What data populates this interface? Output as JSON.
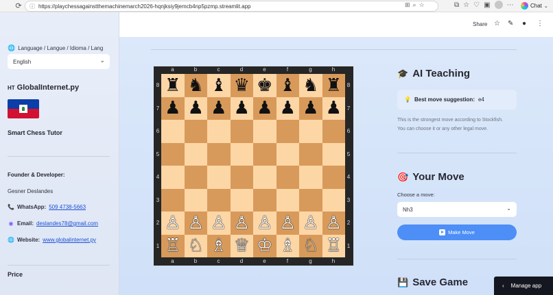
{
  "browser": {
    "url": "https://playchessagainstthemachinemarch2026-hqnjksiy9jemcb4np5pzmp.streamlit.app",
    "chat_label": "Chat"
  },
  "sidebar": {
    "language_label": "Language / Langue / Idioma / Lang",
    "language_value": "English",
    "brand_prefix": "HT",
    "brand_name": "GlobalInternet.py",
    "tutor_title": "Smart Chess Tutor",
    "founder_heading": "Founder & Developer:",
    "founder_name": "Gesner Deslandes",
    "whatsapp_label": "WhatsApp:",
    "whatsapp_value": "509 4738-5663",
    "email_label": "Email:",
    "email_value": "deslandes78@gmail.com",
    "website_label": "Website:",
    "website_value": "www.globalinternet.py",
    "price_heading": "Price"
  },
  "header": {
    "share_label": "Share"
  },
  "board": {
    "files": [
      "a",
      "b",
      "c",
      "d",
      "e",
      "f",
      "g",
      "h"
    ],
    "ranks": [
      "8",
      "7",
      "6",
      "5",
      "4",
      "3",
      "2",
      "1"
    ],
    "position": [
      [
        "♜",
        "♞",
        "♝",
        "♛",
        "♚",
        "♝",
        "♞",
        "♜"
      ],
      [
        "♟",
        "♟",
        "♟",
        "♟",
        "♟",
        "♟",
        "♟",
        "♟"
      ],
      [
        "",
        "",
        "",
        "",
        "",
        "",
        "",
        ""
      ],
      [
        "",
        "",
        "",
        "",
        "",
        "",
        "",
        ""
      ],
      [
        "",
        "",
        "",
        "",
        "",
        "",
        "",
        ""
      ],
      [
        "",
        "",
        "",
        "",
        "",
        "",
        "",
        ""
      ],
      [
        "♙",
        "♙",
        "♙",
        "♙",
        "♙",
        "♙",
        "♙",
        "♙"
      ],
      [
        "♖",
        "♘",
        "♗",
        "♕",
        "♔",
        "♗",
        "♘",
        "♖"
      ]
    ],
    "light_color": "#fdd6a6",
    "dark_color": "#d89a5a"
  },
  "teaching": {
    "title": "AI Teaching",
    "suggestion_label": "Best move suggestion:",
    "suggestion_value": "e4",
    "caption_line1": "This is the strongest move according to Stockfish.",
    "caption_line2": "You can choose it or any other legal move."
  },
  "your_move": {
    "title": "Your Move",
    "choose_label": "Choose a move:",
    "selected_move": "Nh3",
    "make_move_label": "Make Move"
  },
  "save_game": {
    "title": "Save Game"
  },
  "manage_app_label": "Manage app",
  "colors": {
    "accent": "#4d8ef7",
    "link": "#1a4fd6"
  }
}
